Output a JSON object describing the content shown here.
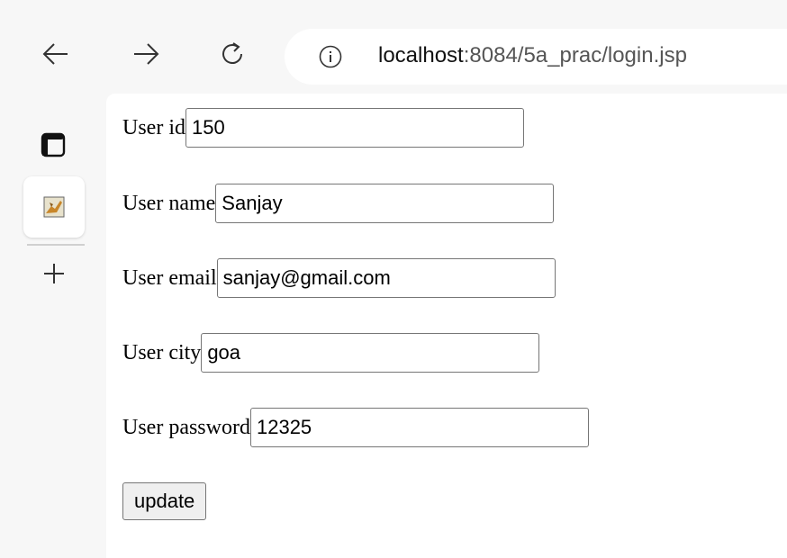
{
  "browser": {
    "back_icon": "arrow-left-icon",
    "forward_icon": "arrow-right-icon",
    "reload_icon": "reload-icon",
    "site_info_icon": "info-icon",
    "url_host": "localhost",
    "url_rest": ":8084/5a_prac/login.jsp"
  },
  "sidebar": {
    "tabs_icon": "tab-actions-icon",
    "active_tab_icon": "favicon-tab-icon",
    "new_tab_icon": "plus-icon"
  },
  "form": {
    "fields": [
      {
        "label": "User id",
        "value": "150"
      },
      {
        "label": "User name",
        "value": "Sanjay"
      },
      {
        "label": "User email",
        "value": "sanjay@gmail.com"
      },
      {
        "label": "User city",
        "value": "goa"
      },
      {
        "label": "User password",
        "value": "12325"
      }
    ],
    "submit_label": "update"
  }
}
